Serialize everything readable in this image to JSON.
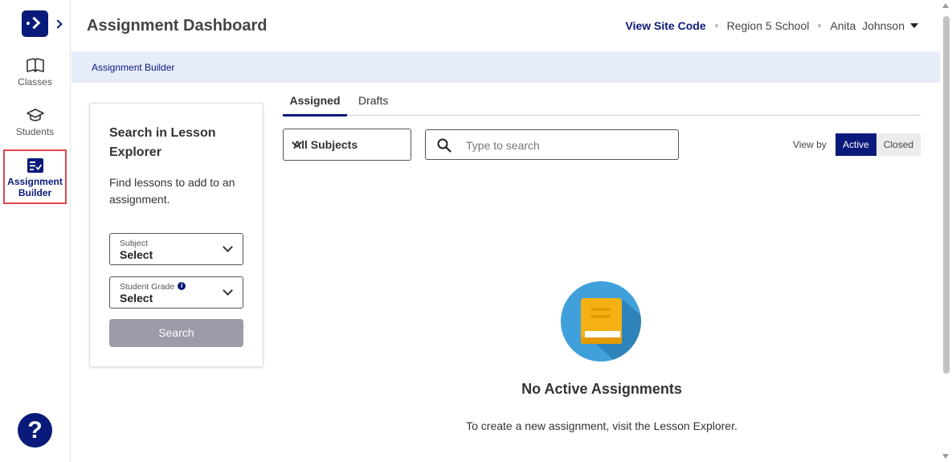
{
  "sidebar": {
    "items": [
      {
        "label": "Classes",
        "icon": "book-open-icon"
      },
      {
        "label": "Students",
        "icon": "graduation-cap-icon"
      },
      {
        "label": "Assignment Builder",
        "icon": "checklist-icon"
      }
    ],
    "help_label": "?"
  },
  "header": {
    "title": "Assignment Dashboard",
    "site_code": "View Site Code",
    "school": "Region 5 School",
    "user_first": "Anita",
    "user_last": "Johnson"
  },
  "breadcrumb": "Assignment Builder",
  "lesson_search": {
    "title": "Search in Lesson Explorer",
    "description": "Find lessons to add to an assignment.",
    "subject_label": "Subject",
    "subject_value": "Select",
    "grade_label": "Student Grade",
    "grade_value": "Select",
    "button": "Search"
  },
  "tabs": [
    "Assigned",
    "Drafts"
  ],
  "filters": {
    "subject": "All Subjects",
    "search_placeholder": "Type to search",
    "view_by": "View by",
    "view_options": [
      "Active",
      "Closed"
    ],
    "selected_view": "Active"
  },
  "empty_state": {
    "title": "No Active Assignments",
    "subtitle": "To create a new assignment, visit the Lesson Explorer."
  },
  "colors": {
    "brand": "#0a1a7a",
    "highlight": "#e0474c",
    "book_circle": "#3fa0dc",
    "book": "#f5b014"
  }
}
